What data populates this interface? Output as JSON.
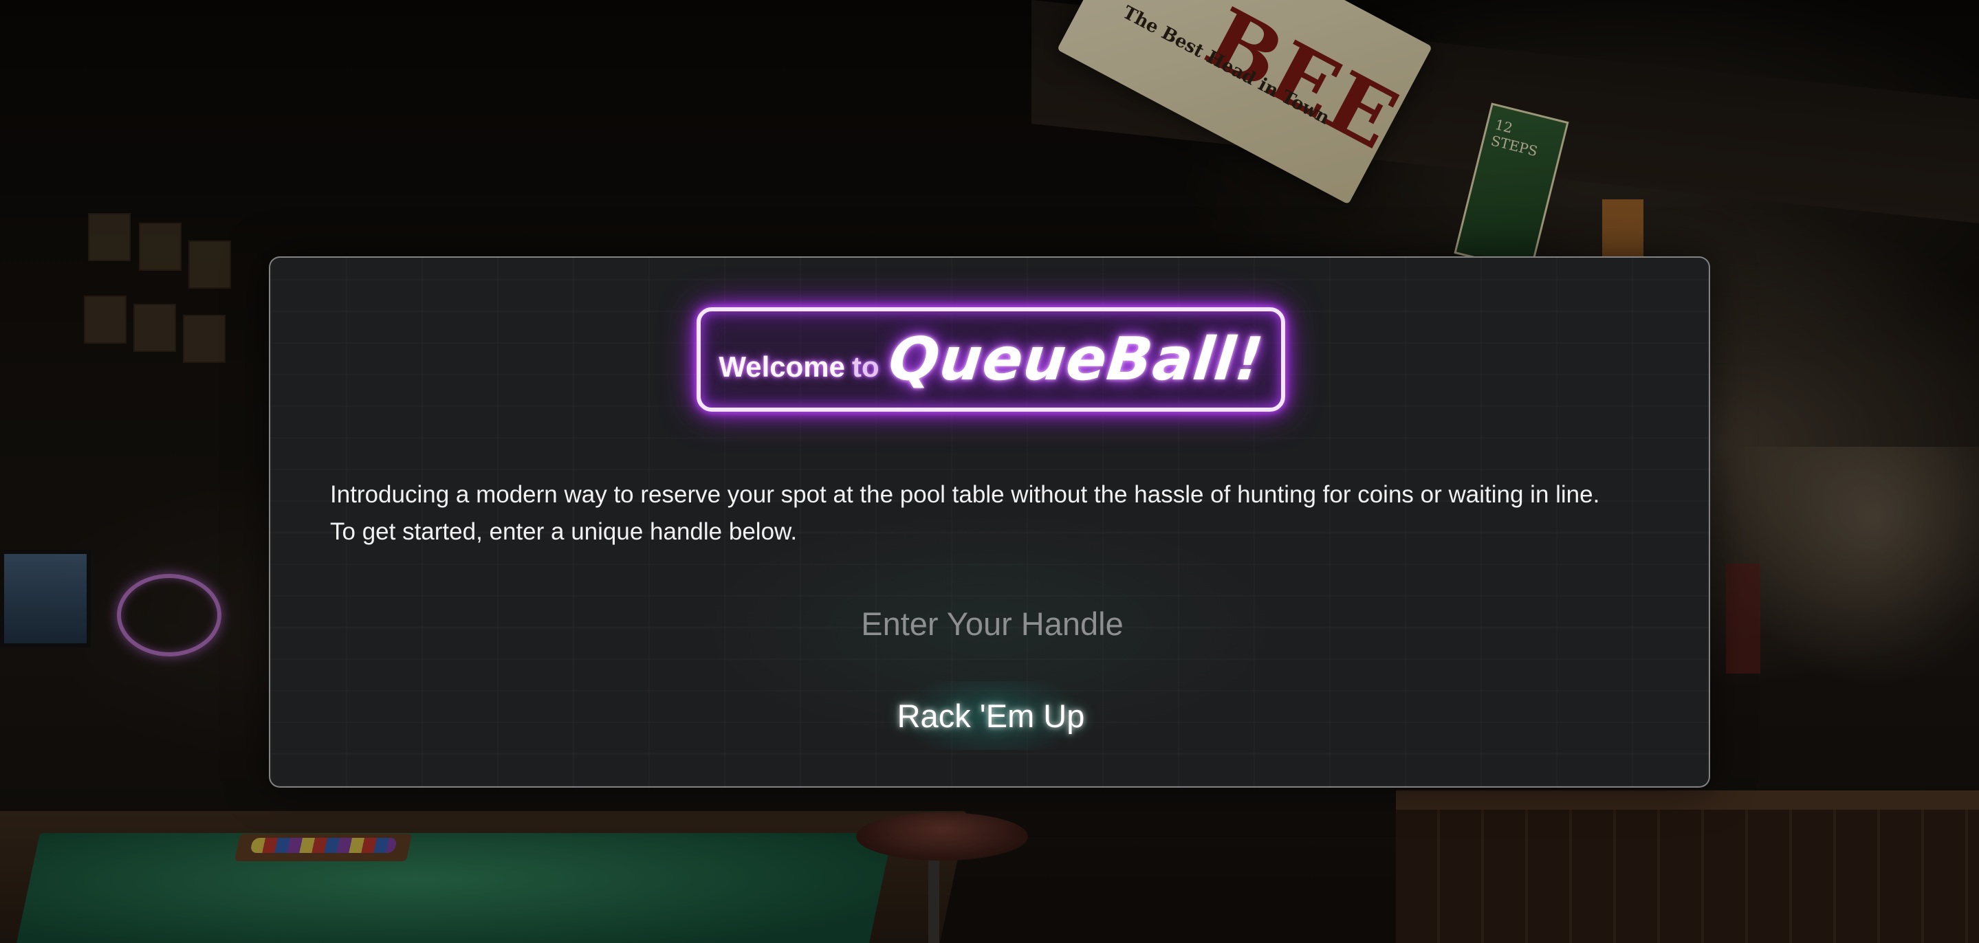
{
  "background": {
    "beer_sign": {
      "word": "BEER",
      "tagline": "The Best Head in Town"
    },
    "poster": {
      "label": "12 STEPS"
    }
  },
  "card": {
    "sign": {
      "welcome": "Welcome",
      "to": "to",
      "brand": "QueueBall!",
      "glow_color": "#b54bff"
    },
    "intro": {
      "line1": "Introducing a modern way to reserve your spot at the pool table without the hassle of hunting for coins or waiting in line.",
      "line2": "To get started, enter a unique handle below."
    },
    "handle_input": {
      "placeholder": "Enter Your Handle",
      "value": ""
    },
    "submit_button": {
      "label": "Rack 'Em Up"
    }
  }
}
